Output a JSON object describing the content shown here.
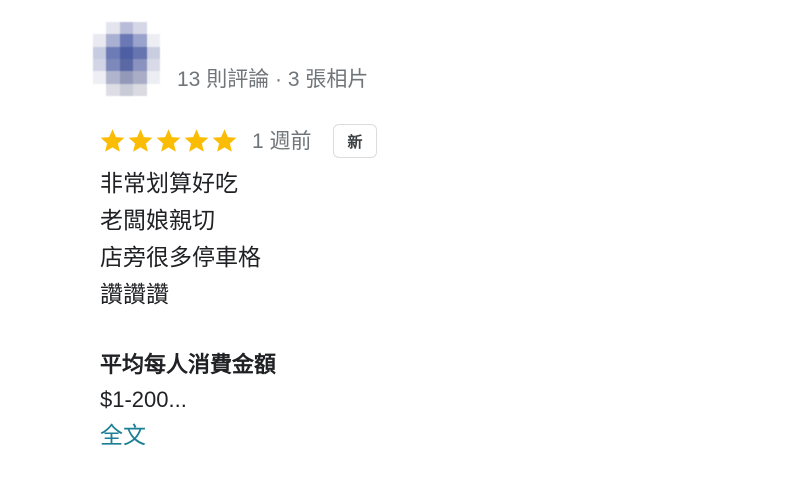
{
  "reviewer": {
    "stats": "13 則評論 · 3 張相片"
  },
  "review": {
    "rating": 5,
    "max_rating": 5,
    "rating_icon": "star-icon",
    "time_ago": "1 週前",
    "badge": "新",
    "lines": [
      "非常划算好吃",
      "老闆娘親切",
      "店旁很多停車格",
      "讚讚讚"
    ]
  },
  "price": {
    "label": "平均每人消費金額",
    "value": "$1-200..."
  },
  "more_link": {
    "label": "全文"
  },
  "colors": {
    "star": "#fbbc04",
    "star_empty": "#dadce0",
    "text": "#202124",
    "muted": "#70757a",
    "link": "#1a7f94"
  }
}
